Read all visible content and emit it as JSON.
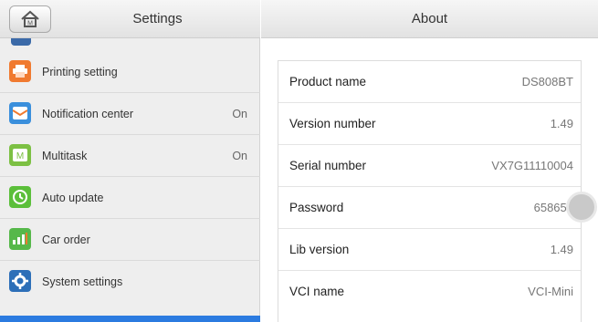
{
  "sidebar": {
    "title": "Settings",
    "items": [
      {
        "label": "Printing setting",
        "value": "",
        "icon": "printer-icon",
        "color": "#f07a30"
      },
      {
        "label": "Notification center",
        "value": "On",
        "icon": "notification-icon",
        "color": "#3a8fdc"
      },
      {
        "label": "Multitask",
        "value": "On",
        "icon": "multitask-icon",
        "color": "#7cc043"
      },
      {
        "label": "Auto update",
        "value": "",
        "icon": "update-icon",
        "color": "#5bbf3a"
      },
      {
        "label": "Car order",
        "value": "",
        "icon": "car-order-icon",
        "color": "#56b84a"
      },
      {
        "label": "System settings",
        "value": "",
        "icon": "gear-icon",
        "color": "#2d6fb8"
      }
    ]
  },
  "about": {
    "title": "About",
    "rows": [
      {
        "label": "Product name",
        "value": "DS808BT"
      },
      {
        "label": "Version number",
        "value": "1.49"
      },
      {
        "label": "Serial number",
        "value": "VX7G11110004"
      },
      {
        "label": "Password",
        "value": "658652"
      },
      {
        "label": "Lib version",
        "value": "1.49"
      },
      {
        "label": "VCI name",
        "value": "VCI-Mini"
      }
    ]
  },
  "colors": {
    "accent": "#2b7be0",
    "sidebar_bg": "#eeeeee"
  }
}
